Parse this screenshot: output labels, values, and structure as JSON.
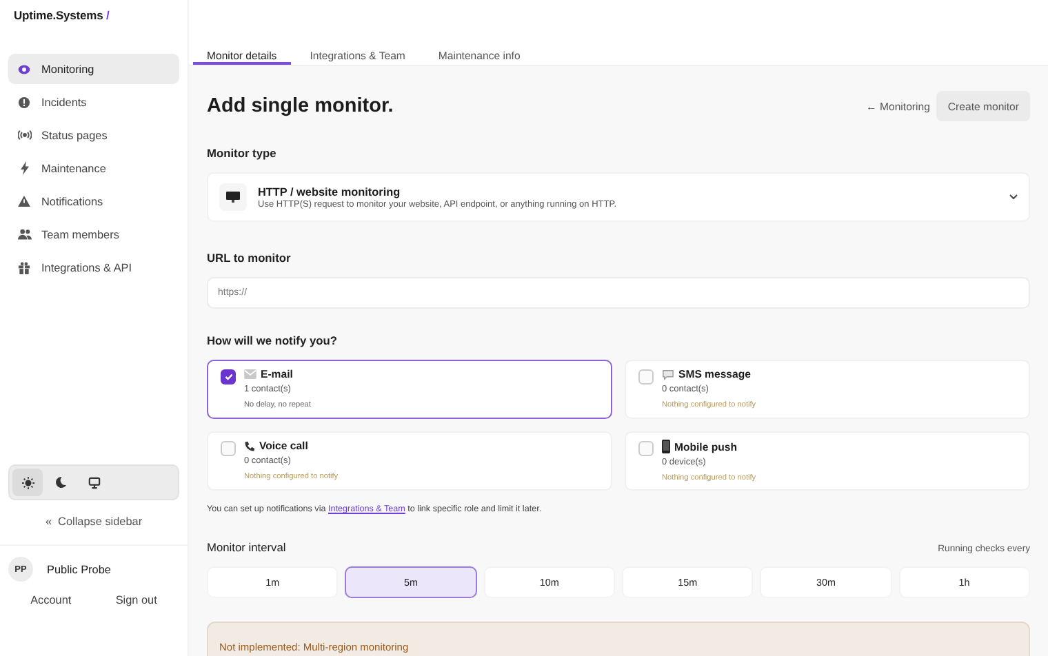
{
  "brand": {
    "name": "Uptime.Systems",
    "slash": "/"
  },
  "sidebar": {
    "items": [
      {
        "label": "Monitoring",
        "kind": "eye",
        "selected": true
      },
      {
        "label": "Incidents",
        "kind": "alert",
        "selected": false
      },
      {
        "label": "Status pages",
        "kind": "broadcast",
        "selected": false
      },
      {
        "label": "Maintenance",
        "kind": "bolt",
        "selected": false
      },
      {
        "label": "Notifications",
        "kind": "warning",
        "selected": false
      },
      {
        "label": "Team members",
        "kind": "users",
        "selected": false
      },
      {
        "label": "Integrations & API",
        "kind": "gift",
        "selected": false
      }
    ],
    "theme_options": [
      {
        "kind": "light",
        "selected": true
      },
      {
        "kind": "dark",
        "selected": false
      },
      {
        "kind": "system",
        "selected": false
      }
    ],
    "collapse": {
      "arrow": "«",
      "label": "Collapse sidebar"
    },
    "user": {
      "initials": "PP",
      "name": "Public Probe"
    },
    "links": [
      "Account",
      "Sign out"
    ]
  },
  "tabs": [
    {
      "label": "Monitor details",
      "selected": true
    },
    {
      "label": "Integrations & Team",
      "selected": false
    },
    {
      "label": "Maintenance info",
      "selected": false
    }
  ],
  "header": {
    "title": "Add single monitor.",
    "back_link": "← Monitoring",
    "button": "Create monitor"
  },
  "monitor_type": {
    "label": "Monitor type",
    "title": "HTTP / website monitoring",
    "description": "Use HTTP(S) request to monitor your website, API endpoint, or anything running on HTTP."
  },
  "url": {
    "label": "URL to monitor",
    "placeholder": "https://"
  },
  "notify": {
    "label": "How will we notify you?",
    "channels": [
      {
        "kind": "mail",
        "name": "E-mail",
        "count": "1 contact(s)",
        "note": "No delay, no repeat",
        "checked": true
      },
      {
        "kind": "chat",
        "name": "SMS message",
        "count": "0 contact(s)",
        "note": "Nothing configured to notify",
        "checked": false
      },
      {
        "kind": "phone",
        "name": "Voice call",
        "count": "0 contact(s)",
        "note": "Nothing configured to notify",
        "checked": false
      },
      {
        "kind": "mobile",
        "name": "Mobile push",
        "count": "0 device(s)",
        "note": "Nothing configured to notify",
        "checked": false
      }
    ],
    "help_before": "You can set up notifications via",
    "help_link": "Integrations & Team",
    "help_after": "to link specific role and limit it later."
  },
  "interval": {
    "label": "Monitor interval",
    "hint": "Running checks every",
    "options": [
      {
        "label": "1m",
        "selected": false
      },
      {
        "label": "5m",
        "selected": true
      },
      {
        "label": "10m",
        "selected": false
      },
      {
        "label": "15m",
        "selected": false
      },
      {
        "label": "30m",
        "selected": false
      },
      {
        "label": "1h",
        "selected": false
      }
    ]
  },
  "warning": {
    "text": "Not implemented: Multi-region monitoring"
  }
}
